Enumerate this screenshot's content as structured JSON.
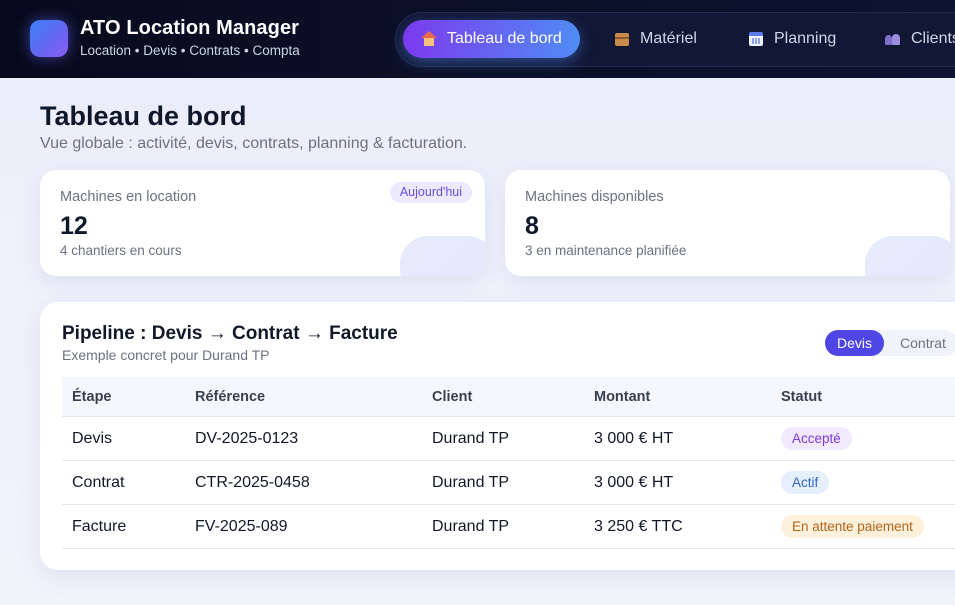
{
  "app": {
    "title": "ATO Location Manager",
    "subtitle": "Location • Devis • Contrats • Compta"
  },
  "nav": {
    "items": [
      {
        "label": "Tableau de bord",
        "icon": "house-icon",
        "active": true
      },
      {
        "label": "Matériel",
        "icon": "package-icon",
        "active": false
      },
      {
        "label": "Planning",
        "icon": "calendar-icon",
        "active": false
      },
      {
        "label": "Clients",
        "icon": "people-icon",
        "active": false
      }
    ]
  },
  "page": {
    "title": "Tableau de bord",
    "subtitle": "Vue globale : activité, devis, contrats, planning & facturation."
  },
  "kpis": [
    {
      "label": "Machines en location",
      "value": "12",
      "note": "4 chantiers en cours",
      "badge": "Aujourd'hui"
    },
    {
      "label": "Machines disponibles",
      "value": "8",
      "note": "3 en maintenance planifiée"
    }
  ],
  "pipeline": {
    "title": "Pipeline : Devis → Contrat → Facture",
    "subtitle": "Exemple concret pour Durand TP",
    "segments": [
      {
        "label": "Devis",
        "active": true
      },
      {
        "label": "Contrat",
        "active": false
      }
    ],
    "columns": [
      "Étape",
      "Référence",
      "Client",
      "Montant",
      "Statut"
    ],
    "rows": [
      {
        "etape": "Devis",
        "reference": "DV-2025-0123",
        "client": "Durand TP",
        "montant": "3 000 € HT",
        "statut": "Accepté",
        "statut_bg": "#f1e9fd",
        "statut_color": "#7e3bd6"
      },
      {
        "etape": "Contrat",
        "reference": "CTR-2025-0458",
        "client": "Durand TP",
        "montant": "3 000 € HT",
        "statut": "Actif",
        "statut_bg": "#e6f0fd",
        "statut_color": "#2f66c4"
      },
      {
        "etape": "Facture",
        "reference": "FV-2025-089",
        "client": "Durand TP",
        "montant": "3 250 € TTC",
        "statut": "En attente paiement",
        "statut_bg": "#fdf1dc",
        "statut_color": "#b2641a"
      }
    ]
  }
}
